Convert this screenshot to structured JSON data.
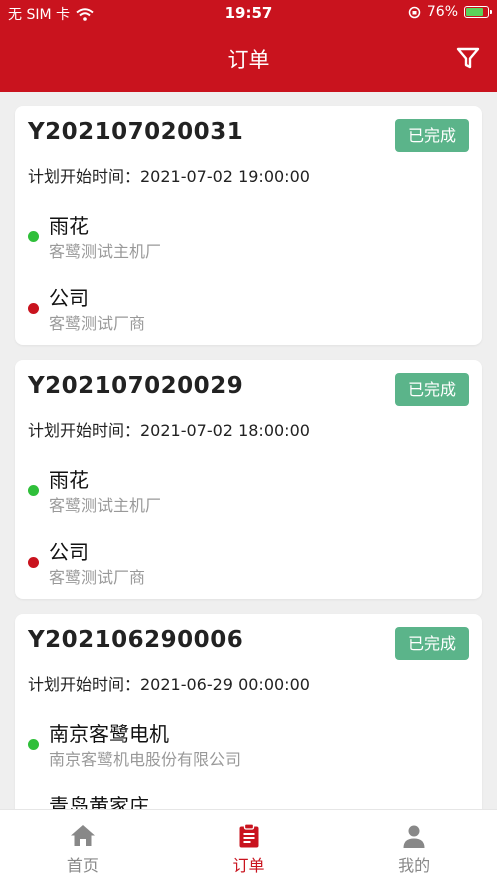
{
  "status_bar": {
    "carrier": "无 SIM 卡",
    "time": "19:57",
    "battery": "76%"
  },
  "header": {
    "title": "订单"
  },
  "orders": [
    {
      "order_no": "Y202107020031",
      "status": "已完成",
      "plan_time_label": "计划开始时间：2021-07-02 19:00:00",
      "from": {
        "name": "雨花",
        "sub": "客鹭测试主机厂"
      },
      "to": {
        "name": "公司",
        "sub": "客鹭测试厂商"
      }
    },
    {
      "order_no": "Y202107020029",
      "status": "已完成",
      "plan_time_label": "计划开始时间：2021-07-02 18:00:00",
      "from": {
        "name": "雨花",
        "sub": "客鹭测试主机厂"
      },
      "to": {
        "name": "公司",
        "sub": "客鹭测试厂商"
      }
    },
    {
      "order_no": "Y202106290006",
      "status": "已完成",
      "plan_time_label": "计划开始时间：2021-06-29 00:00:00",
      "from": {
        "name": "南京客鹭电机",
        "sub": "南京客鹭机电股份有限公司"
      },
      "to": {
        "name": "青岛黄家庄",
        "sub": ""
      }
    }
  ],
  "tabbar": {
    "items": [
      {
        "label": "首页",
        "icon": "home-icon",
        "active": false
      },
      {
        "label": "订单",
        "icon": "clipboard-icon",
        "active": true
      },
      {
        "label": "我的",
        "icon": "user-icon",
        "active": false
      }
    ]
  },
  "colors": {
    "brand": "#c9131e",
    "badge": "#5bb48a",
    "start_dot": "#2fbf3a",
    "end_dot": "#c9131e"
  }
}
